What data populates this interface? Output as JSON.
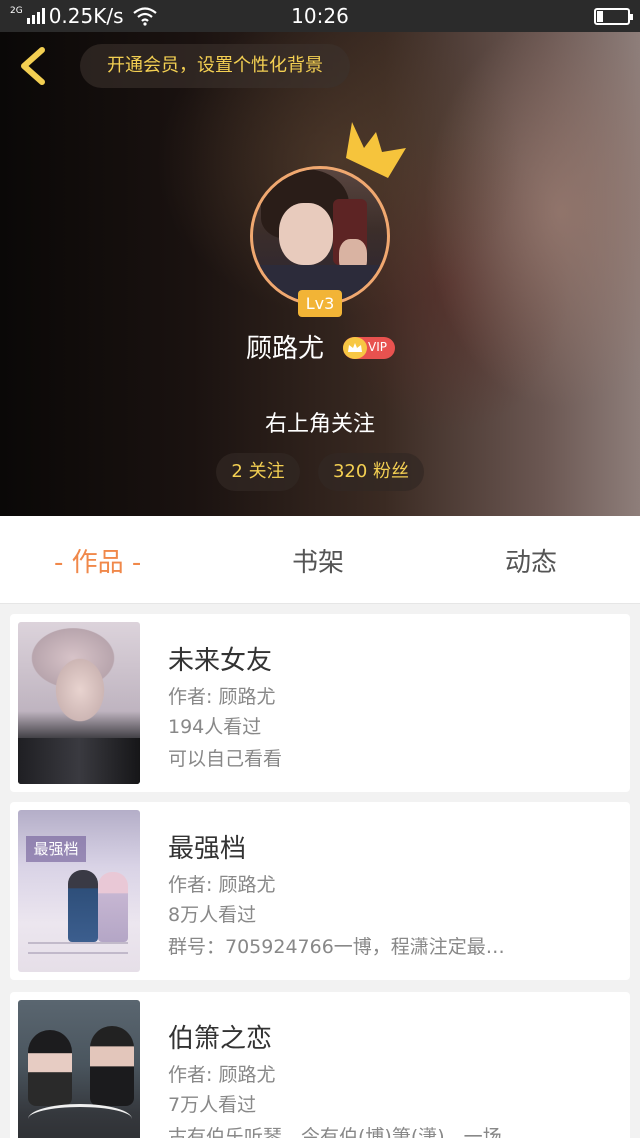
{
  "status_bar": {
    "network_type": "2G",
    "speed": "0.25K/s",
    "time": "10:26",
    "battery_level": 0.2
  },
  "header": {
    "vip_banner": "开通会员，设置个性化背景",
    "level": "Lv3",
    "username": "顾路尤",
    "vip_label": "VIP",
    "follow_hint": "右上角关注",
    "following": "2 关注",
    "fans": "320 粉丝",
    "accent_color": "#f3cf52"
  },
  "tabs": [
    {
      "label": "- 作品 -",
      "active": true
    },
    {
      "label": "书架",
      "active": false
    },
    {
      "label": "动态",
      "active": false
    }
  ],
  "books": [
    {
      "title": "未来女友",
      "author": "作者: 顾路尤",
      "views": "194人看过",
      "desc": "可以自己看看"
    },
    {
      "title": "最强档",
      "author": "作者: 顾路尤",
      "views": "8万人看过",
      "desc": "群号：705924766一博，程潇注定最…",
      "cover_title": "最强档"
    },
    {
      "title": "伯箫之恋",
      "author": "作者: 顾路尤",
      "views": "7万人看过",
      "desc": "古有伯乐听琴，今有伯(博)箫(潇)，一场…"
    }
  ],
  "icons": {
    "back": "chevron-left-icon",
    "crown": "crown-icon",
    "vip_crown": "vip-crown-icon",
    "wifi": "wifi-icon",
    "signal": "signal-icon",
    "battery": "battery-icon"
  }
}
